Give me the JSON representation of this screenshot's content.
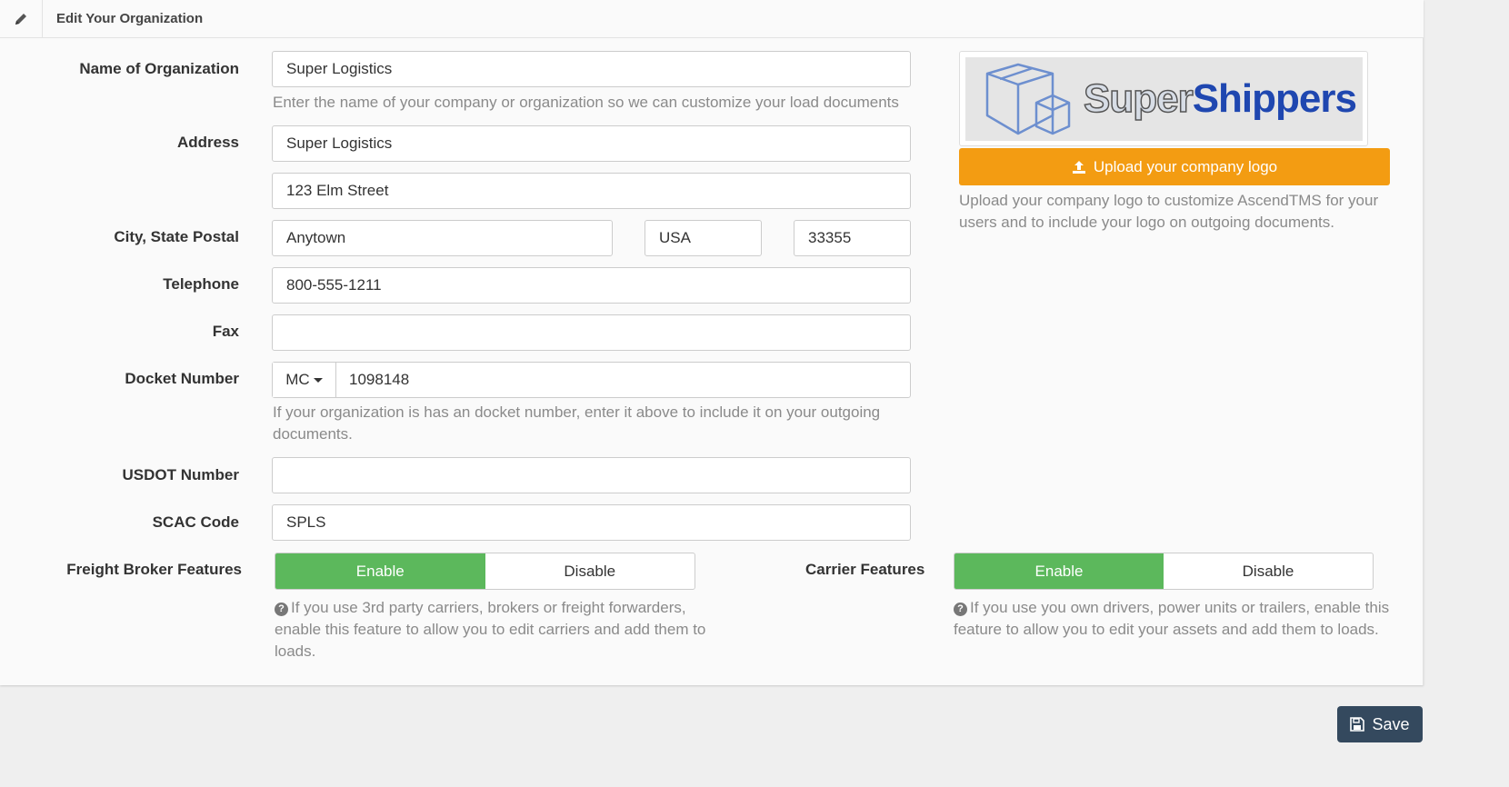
{
  "header": {
    "title": "Edit Your Organization",
    "icon": "pencil-icon"
  },
  "form": {
    "name_label": "Name of Organization",
    "name_value": "Super Logistics",
    "name_help": "Enter the name of your company or organization so we can customize your load documents",
    "address_label": "Address",
    "address1_value": "Super Logistics",
    "address2_value": "123 Elm Street",
    "city_label": "City, State Postal",
    "city_value": "Anytown",
    "state_value": "USA",
    "postal_value": "33355",
    "telephone_label": "Telephone",
    "telephone_value": "800-555-1211",
    "fax_label": "Fax",
    "fax_value": "",
    "docket_label": "Docket Number",
    "docket_prefix": "MC",
    "docket_value": "1098148",
    "docket_help": "If your organization is has an docket number, enter it above to include it on your outgoing documents.",
    "usdot_label": "USDOT Number",
    "usdot_value": "",
    "scac_label": "SCAC Code",
    "scac_value": "SPLS"
  },
  "features": {
    "broker_label": "Freight Broker Features",
    "broker_enable": "Enable",
    "broker_disable": "Disable",
    "broker_selected": "Enable",
    "broker_help": "If you use 3rd party carriers, brokers or freight forwarders, enable this feature to allow you to edit carriers and add them to loads.",
    "carrier_label": "Carrier Features",
    "carrier_enable": "Enable",
    "carrier_disable": "Disable",
    "carrier_selected": "Enable",
    "carrier_help": "If you use you own drivers, power units or trailers, enable this feature to allow you to edit your assets and add them to loads."
  },
  "logo": {
    "text_part1": "Super",
    "text_part2": "Shippers",
    "upload_label": "Upload your company logo",
    "upload_help": "Upload your company logo to customize AscendTMS for your users and to include your logo on outgoing documents."
  },
  "footer": {
    "save_label": "Save"
  },
  "colors": {
    "enable_green": "#5cb85c",
    "upload_orange": "#f39c12",
    "save_navy": "#34495e"
  }
}
